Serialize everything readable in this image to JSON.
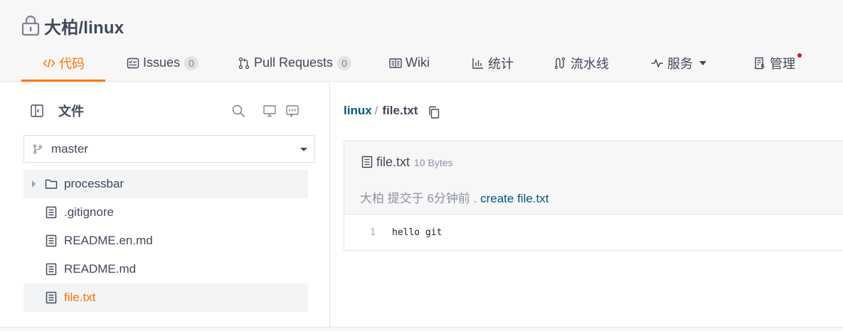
{
  "repo": {
    "name": "大柏/linux"
  },
  "tabs": [
    {
      "label": "代码",
      "icon": "code-icon",
      "active": true
    },
    {
      "label": "Issues",
      "icon": "issues-icon",
      "count": "0"
    },
    {
      "label": "Pull Requests",
      "icon": "pull-request-icon",
      "count": "0"
    },
    {
      "label": "Wiki",
      "icon": "wiki-icon"
    },
    {
      "label": "统计",
      "icon": "stats-icon"
    },
    {
      "label": "流水线",
      "icon": "pipeline-icon"
    },
    {
      "label": "服务",
      "icon": "service-icon",
      "dropdown": true
    },
    {
      "label": "管理",
      "icon": "manage-icon",
      "notification_dot": true
    }
  ],
  "sidebar": {
    "title": "文件",
    "branch": "master",
    "tree": [
      {
        "label": "processbar",
        "type": "folder"
      },
      {
        "label": ".gitignore",
        "type": "file"
      },
      {
        "label": "README.en.md",
        "type": "file"
      },
      {
        "label": "README.md",
        "type": "file"
      },
      {
        "label": "file.txt",
        "type": "file",
        "active": true
      }
    ]
  },
  "breadcrumb": {
    "repo": "linux",
    "sep": "/",
    "file": "file.txt"
  },
  "file": {
    "name": "file.txt",
    "size": "10 Bytes",
    "commit_meta": "大柏 提交于 6分钟前 .",
    "commit_message": "create file.txt",
    "lines": [
      {
        "no": "1",
        "text": "hello git"
      }
    ]
  },
  "colors": {
    "accent": "#fe7300",
    "link": "#005980",
    "text": "#40485b",
    "muted": "#8c92a4"
  }
}
